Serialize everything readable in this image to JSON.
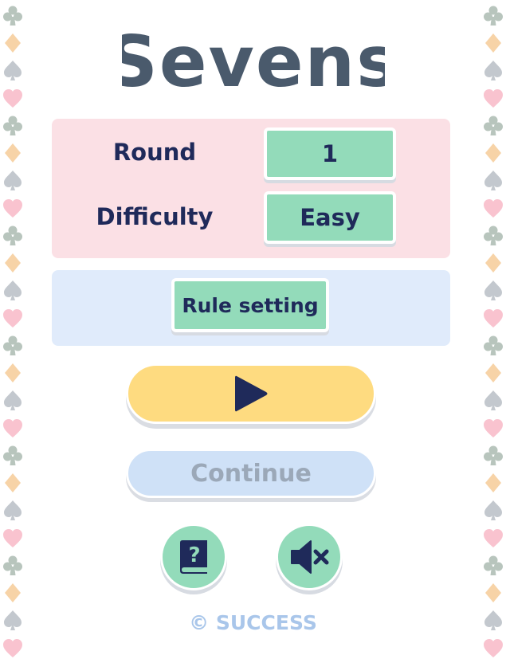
{
  "app": {
    "title": "Sevens"
  },
  "settings": {
    "round_label": "Round",
    "round_value": "1",
    "difficulty_label": "Difficulty",
    "difficulty_value": "Easy"
  },
  "buttons": {
    "rule_setting": "Rule setting",
    "play_icon": "play-icon",
    "continue": "Continue",
    "help_icon": "help-book-icon",
    "sound_icon": "sound-muted-icon"
  },
  "footer": {
    "copyright": "© SUCCESS"
  },
  "border": {
    "pattern": [
      "spade",
      "heart",
      "club",
      "diamond"
    ]
  },
  "colors": {
    "ink": "#1f2a5a",
    "mint": "#93dbba",
    "pink_panel": "#fbe0e5",
    "blue_panel": "#e0ebfb",
    "play_yellow": "#fedb80",
    "continue_disabled": "#cfe1f7",
    "club": "#b8c5bd",
    "diamond": "#f7d3a7",
    "spade": "#c3c8ce",
    "heart": "#f9c3cf"
  }
}
